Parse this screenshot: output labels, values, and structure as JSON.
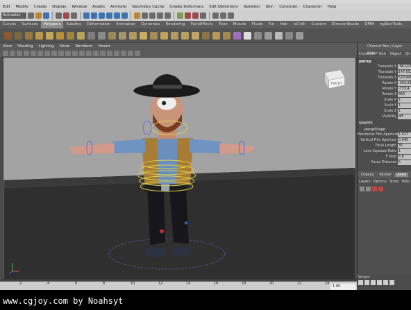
{
  "menu_items": [
    "Edit",
    "Modify",
    "Create",
    "Display",
    "Window",
    "Assets",
    "Animate",
    "Geometry Cache",
    "Create Deformers",
    "Edit Deformers",
    "Skeleton",
    "Skin",
    "Constrain",
    "Character",
    "Help"
  ],
  "status": {
    "mode": "Animation"
  },
  "shelf_tabs": [
    "Curves",
    "Surfaces",
    "Polygons",
    "Subdivs",
    "Deformation",
    "Animation",
    "Dynamics",
    "Rendering",
    "PaintEffects",
    "Toon",
    "Muscle",
    "Fluids",
    "Fur",
    "Hair",
    "nCloth",
    "Custom",
    "DirectorStudio",
    "DMM",
    "ngSkinTools"
  ],
  "shelf_active": "Polygons",
  "panel_menu": [
    "View",
    "Shading",
    "Lighting",
    "Show",
    "Renderer",
    "Panels"
  ],
  "viewcube_label": "FRONT",
  "channel_box": {
    "title": "Channel Box / Layer Editor",
    "menu": [
      "Channels",
      "Edit",
      "Object",
      "Sh"
    ],
    "node": "persp",
    "attributes": [
      {
        "label": "Translate X",
        "value": "-66.115"
      },
      {
        "label": "Translate Y",
        "value": "147.052"
      },
      {
        "label": "Translate Z",
        "value": "523.445"
      },
      {
        "label": "Rotate X",
        "value": "-350.082"
      },
      {
        "label": "Rotate Y",
        "value": "-733.4"
      },
      {
        "label": "Rotate Z",
        "value": "360"
      },
      {
        "label": "Scale X",
        "value": "1"
      },
      {
        "label": "Scale Y",
        "value": "1"
      },
      {
        "label": "Scale Z",
        "value": "1"
      },
      {
        "label": "Visibility",
        "value": "off"
      }
    ],
    "shapes_heading": "SHAPES",
    "shape_node": "perspShape",
    "shape_attributes": [
      {
        "label": "Horizontal Film Aperture",
        "value": "1.417"
      },
      {
        "label": "Vertical Film Aperture",
        "value": "0.945"
      },
      {
        "label": "Focal Length",
        "value": "35"
      },
      {
        "label": "Lens Squeeze Ratio",
        "value": "1"
      },
      {
        "label": "F Stop",
        "value": "5.6"
      },
      {
        "label": "Focus Distance",
        "value": "5"
      }
    ]
  },
  "layer_editor": {
    "tabs": [
      "Display",
      "Render",
      "Anim"
    ],
    "active_tab": "Anim",
    "menu": [
      "Layers",
      "Options",
      "Show",
      "Help"
    ]
  },
  "timeline": {
    "ticks": [
      "2",
      "4",
      "6",
      "8",
      "10",
      "12",
      "14",
      "16",
      "18",
      "20",
      "22",
      "24"
    ],
    "current_frame": "1.00"
  },
  "weight_label": "Weight",
  "watermark": "www.cgjoy.com by Noahsyt"
}
